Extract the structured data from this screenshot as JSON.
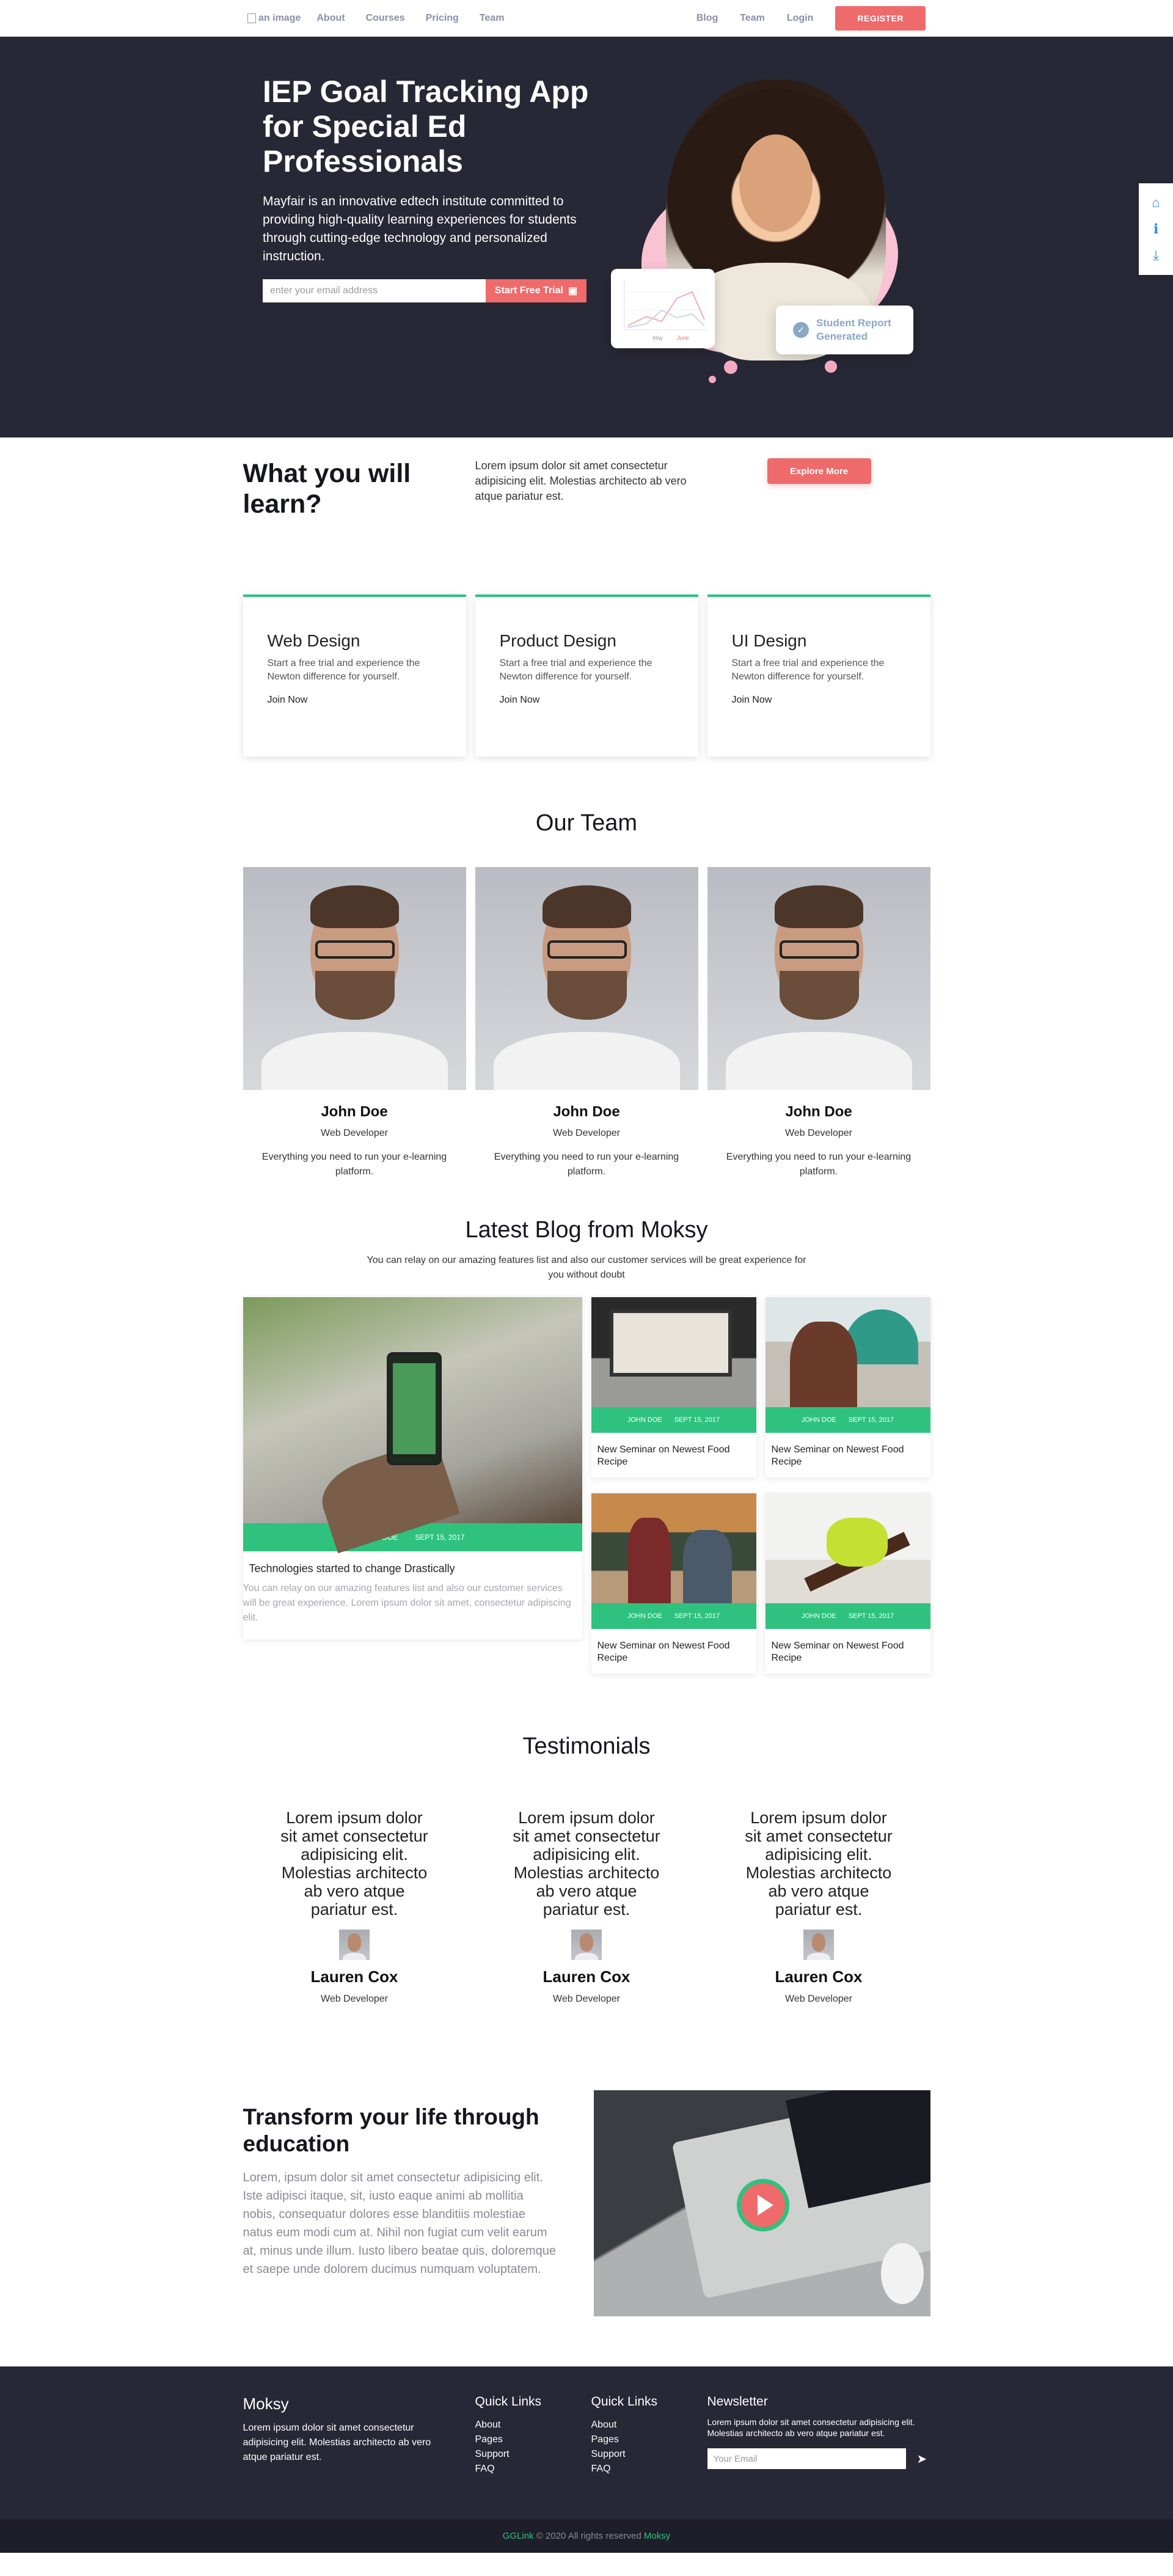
{
  "nav": {
    "logo_alt": "an image",
    "left_links": [
      "About",
      "Courses",
      "Pricing",
      "Team"
    ],
    "right_links": [
      "Blog",
      "Team",
      "Login"
    ],
    "register": "REGISTER"
  },
  "hero": {
    "title": "IEP Goal Tracking App for Special Ed Professionals",
    "description": "Mayfair is an innovative edtech institute committed to providing high-quality learning experiences for students through cutting-edge technology and personalized instruction.",
    "email_placeholder": "enter your email address",
    "cta": "Start Free Trial",
    "report_badge": "Student Report Generated",
    "chart_labels": [
      "May",
      "June"
    ]
  },
  "side_tools": {
    "icons": [
      "home-icon",
      "info-icon",
      "download-icon"
    ],
    "glyphs": [
      "⌂",
      "ℹ",
      "⤓"
    ],
    "color": "#2d8fe0"
  },
  "learn": {
    "title": "What you will learn?",
    "text": "Lorem ipsum dolor sit amet consectetur adipisicing elit. Molestias architecto ab vero atque pariatur est.",
    "button": "Explore More"
  },
  "courses": [
    {
      "title": "Web Design",
      "text": "Start a free trial and experience the Newton difference for yourself.",
      "link": "Join Now"
    },
    {
      "title": "Product Design",
      "text": "Start a free trial and experience the Newton difference for yourself.",
      "link": "Join Now"
    },
    {
      "title": "UI Design",
      "text": "Start a free trial and experience the Newton difference for yourself.",
      "link": "Join Now"
    }
  ],
  "team": {
    "title": "Our Team",
    "members": [
      {
        "name": "John Doe",
        "role": "Web Developer",
        "desc": "Everything you need to run your e-learning platform."
      },
      {
        "name": "John Doe",
        "role": "Web Developer",
        "desc": "Everything you need to run your e-learning platform."
      },
      {
        "name": "John Doe",
        "role": "Web Developer",
        "desc": "Everything you need to run your e-learning platform."
      }
    ]
  },
  "blog": {
    "title": "Latest Blog from Moksy",
    "subtitle": "You can relay on our amazing features list and also our customer services will be great experience for you without doubt",
    "featured": {
      "author": "JOHN DOE",
      "date": "SEPT 15, 2017",
      "title": "Technologies started to change Drastically",
      "excerpt": "You can relay on our amazing features list and also our customer services will be great experience. Lorem ipsum dolor sit amet, consectetur adipiscing elit."
    },
    "posts": [
      {
        "author": "JOHN DOE",
        "date": "SEPT 15, 2017",
        "title": "New Seminar on Newest Food Recipe"
      },
      {
        "author": "JOHN DOE",
        "date": "SEPT 15, 2017",
        "title": "New Seminar on Newest Food Recipe"
      },
      {
        "author": "JOHN DOE",
        "date": "SEPT 15, 2017",
        "title": "New Seminar on Newest Food Recipe"
      },
      {
        "author": "JOHN DOE",
        "date": "SEPT 15, 2017",
        "title": "New Seminar on Newest Food Recipe"
      }
    ]
  },
  "testimonials": {
    "title": "Testimonials",
    "items": [
      {
        "quote": "Lorem ipsum dolor sit amet consectetur adipisicing elit. Molestias architecto ab vero atque pariatur est.",
        "name": "Lauren Cox",
        "role": "Web Developer"
      },
      {
        "quote": "Lorem ipsum dolor sit amet consectetur adipisicing elit. Molestias architecto ab vero atque pariatur est.",
        "name": "Lauren Cox",
        "role": "Web Developer"
      },
      {
        "quote": "Lorem ipsum dolor sit amet consectetur adipisicing elit. Molestias architecto ab vero atque pariatur est.",
        "name": "Lauren Cox",
        "role": "Web Developer"
      }
    ]
  },
  "transform": {
    "title": "Transform your life through education",
    "text": "Lorem, ipsum dolor sit amet consectetur adipisicing elit. Iste adipisci itaque, sit, iusto eaque animi ab mollitia nobis, consequatur dolores esse blanditiis molestiae natus eum modi cum at. Nihil non fugiat cum velit earum at, minus unde illum. Iusto libero beatae quis, doloremque et saepe unde dolorem ducimus numquam voluptatem."
  },
  "footer": {
    "brand": "Moksy",
    "brand_text": "Lorem ipsum dolor sit amet consectetur adipisicing elit. Molestias architecto ab vero atque pariatur est.",
    "quick_links_1": {
      "title": "Quick Links",
      "items": [
        "About",
        "Pages",
        "Support",
        "FAQ"
      ]
    },
    "quick_links_2": {
      "title": "Quick Links",
      "items": [
        "About",
        "Pages",
        "Support",
        "FAQ"
      ]
    },
    "newsletter": {
      "title": "Newsletter",
      "text": "Lorem ipsum dolor sit amet consectetur adipisicing elit. Molestias architecto ab vero atque pariatur est.",
      "placeholder": "Your Email"
    },
    "copyright_brand": "GGLink",
    "copyright_text": "© 2020 All rights reserved",
    "copyright_tail": "Moksy"
  },
  "colors": {
    "accent": "#ef6a6a",
    "green": "#2ec27e",
    "dark": "#272835"
  }
}
